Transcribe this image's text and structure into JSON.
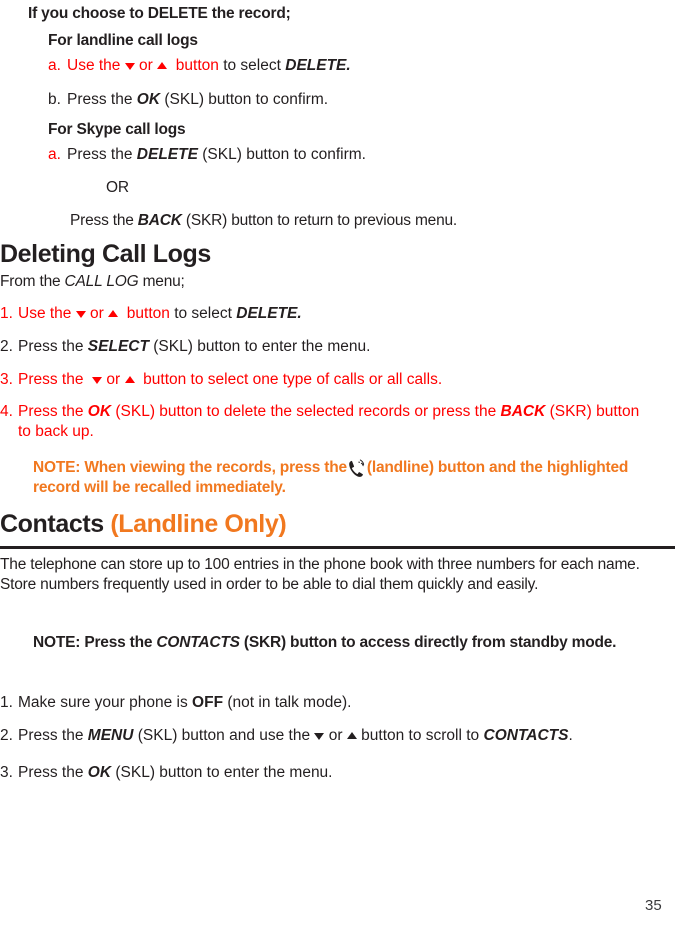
{
  "page": {
    "number": "35",
    "colors": {
      "text": "#231f20",
      "red": "#ff0000",
      "orange": "#f1781f",
      "rule": "#231f20"
    }
  },
  "intro": {
    "heading": "If you choose to DELETE the record;"
  },
  "landline_block": {
    "subheading": "For landline call logs",
    "items": [
      {
        "marker": "a.",
        "marker_color": "red",
        "pre": "Use the",
        "or": "or",
        "mid": "button",
        "post_plain": "to select",
        "post_bold": "DELETE."
      },
      {
        "marker": "b.",
        "text_1": "Press the",
        "bold_1": "OK",
        "text_2": "(SKL) button to confirm."
      }
    ]
  },
  "skype_block": {
    "subheading": "For Skype call logs",
    "items": [
      {
        "marker": "a.",
        "marker_color": "red",
        "text_1": "Press the",
        "bold_1": "DELETE",
        "text_2": "(SKL) button to confirm."
      }
    ],
    "or_label": "OR",
    "back_line": {
      "text_1": "Press the",
      "bold_1": "BACK",
      "text_2": "(SKR) button to return to previous menu."
    }
  },
  "deleting_call_logs": {
    "title": "Deleting Call Logs",
    "intro_pre": "From the",
    "intro_italic": "CALL LOG",
    "intro_post": "menu;",
    "steps": [
      {
        "marker": "1.",
        "color": "red",
        "pre": "Use the",
        "or": "or",
        "mid": "button",
        "post_plain": "to select",
        "post_bold": "DELETE."
      },
      {
        "marker": "2.",
        "color": "dark",
        "text_1": "Press the",
        "bold_1": "SELECT",
        "text_2": "(SKL) button to enter the menu."
      },
      {
        "marker": "3.",
        "color": "red",
        "pre": "Press the",
        "or": "or",
        "post": "button to select one type of calls or all calls."
      },
      {
        "marker": "4.",
        "color": "red",
        "text_1": "Press the",
        "bold_1": "OK",
        "text_2": "(SKL) button to delete the selected records or press the",
        "bold_2": "BACK",
        "text_3": "(SKR) button to back up."
      }
    ],
    "note": {
      "text_1": "NOTE: When viewing the records, press the",
      "icon": "phone-handset-icon",
      "text_2": "(landline) button and the highlighted record will be recalled immediately."
    }
  },
  "contacts": {
    "title_dark": "Contacts",
    "title_orange": "(Landline Only)",
    "paragraph": "The telephone can store up to 100 entries in the phone book with three numbers for each name. Store numbers frequently used in order to be able to dial them quickly and easily.",
    "note": {
      "text_1": "NOTE: Press the",
      "italic_1": "CONTACTS",
      "text_2": "(SKR) button to access directly from standby mode."
    },
    "steps": [
      {
        "marker": "1.",
        "text_1": "Make sure your phone is",
        "bold_1": "OFF",
        "text_2": "(not in talk mode)."
      },
      {
        "marker": "2.",
        "text_1": "Press the",
        "bold_1": "MENU",
        "text_2": "(SKL) button and use the",
        "or": "or",
        "text_3": "button to scroll to",
        "bold_2": "CONTACTS",
        "text_4": "."
      },
      {
        "marker": "3.",
        "text_1": "Press the",
        "bold_1": "OK",
        "text_2": "(SKL) button to enter the menu."
      }
    ]
  }
}
